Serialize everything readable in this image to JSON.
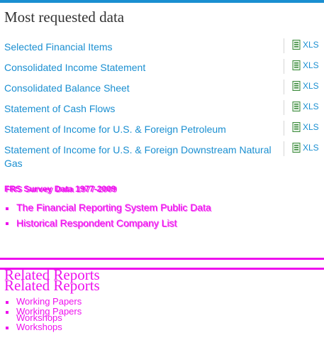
{
  "main": {
    "title": "Most requested data",
    "items": [
      {
        "label": "Selected Financial Items",
        "file": "XLS"
      },
      {
        "label": "Consolidated Income Statement",
        "file": "XLS"
      },
      {
        "label": "Consolidated Balance Sheet",
        "file": "XLS"
      },
      {
        "label": "Statement of Cash Flows",
        "file": "XLS"
      },
      {
        "label": "Statement of Income for U.S. & Foreign Petroleum",
        "file": "XLS"
      },
      {
        "label": "Statement of Income for U.S. & Foreign Downstream Natural Gas",
        "file": "XLS"
      }
    ]
  },
  "frs": {
    "heading_a": "FRS Survey Data 1977-2009",
    "heading_b": "FRS Survey Data 1977-2009",
    "links": [
      "The Financial Reporting System Public Data",
      "Historical Respondent Company List"
    ]
  },
  "related": {
    "title": "Related Reports",
    "items": [
      "Working Papers",
      "Workshops"
    ]
  },
  "colors": {
    "link": "#1a8fd1",
    "accent_bar": "#1a8fd1",
    "overlay": "#ee11ee",
    "xls_icon": "#3a8a3a"
  }
}
